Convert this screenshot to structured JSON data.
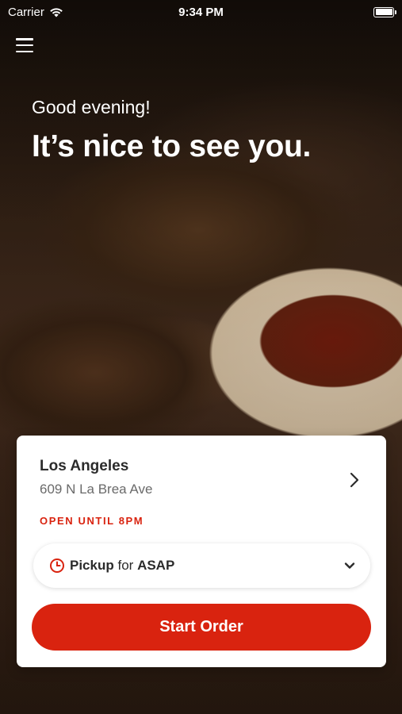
{
  "status_bar": {
    "carrier": "Carrier",
    "time": "9:34 PM",
    "battery_level": 1.0
  },
  "header": {
    "menu_icon": "hamburger-menu-icon",
    "greeting": "Good evening!",
    "headline": "It’s nice to see you."
  },
  "location_card": {
    "name": "Los Angeles",
    "address": "609 N La Brea Ave",
    "hours": "OPEN UNTIL 8PM",
    "pickup": {
      "mode": "Pickup",
      "connector": "for",
      "time": "ASAP"
    },
    "start_order_label": "Start Order"
  },
  "colors": {
    "accent": "#d9230f",
    "card_bg": "#ffffff",
    "text_dark": "#2b2b2b",
    "text_muted": "#6a6a6a"
  }
}
